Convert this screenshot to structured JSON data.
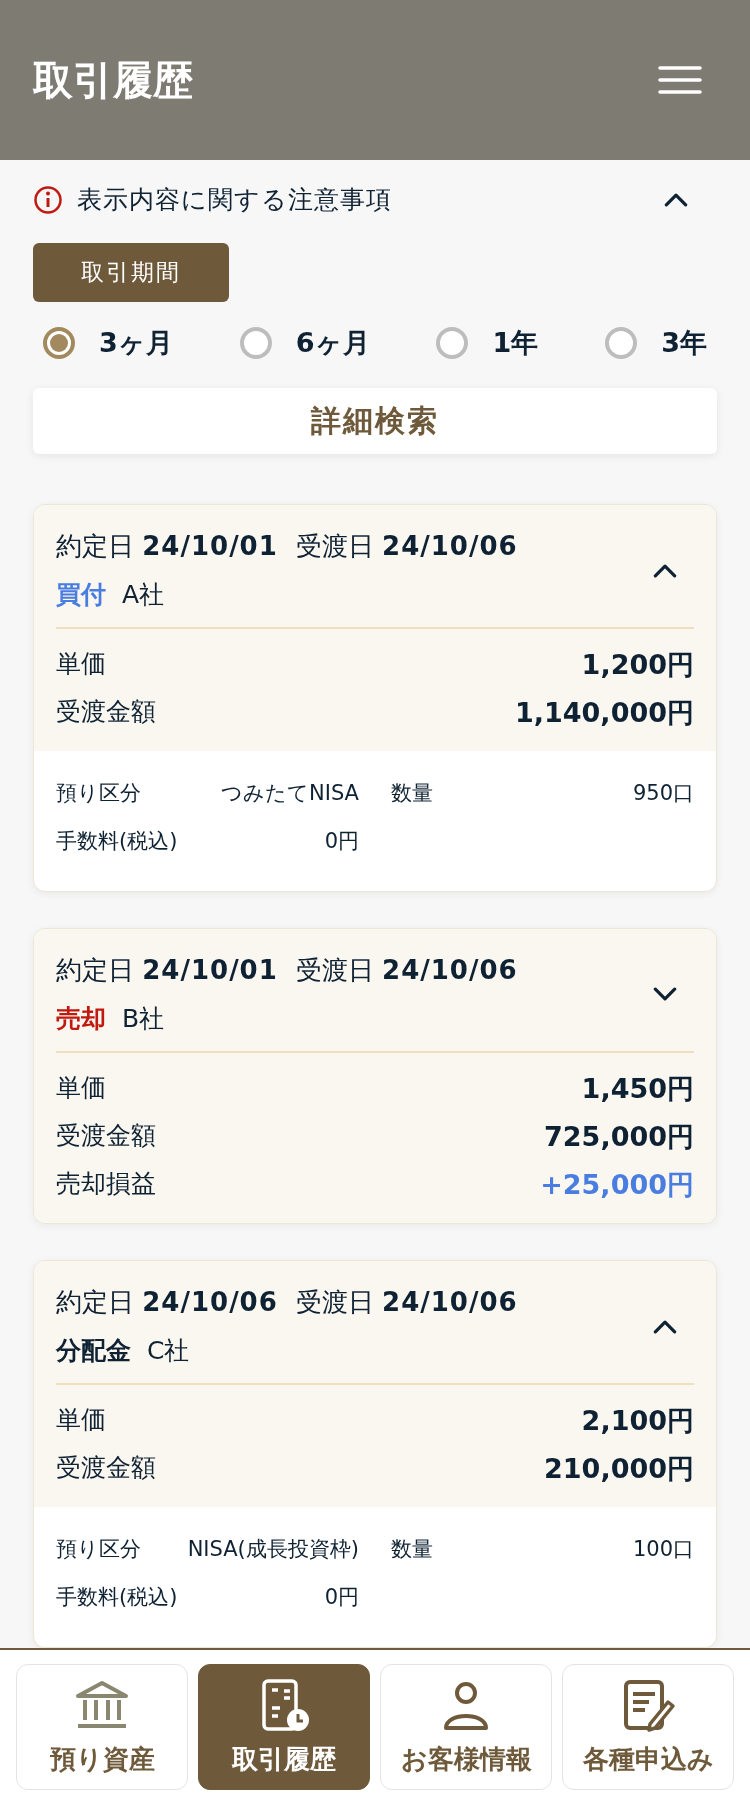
{
  "header": {
    "title": "取引履歴"
  },
  "notice": {
    "label": "表示内容に関する注意事項",
    "expanded": true
  },
  "period": {
    "label": "取引期間",
    "options": [
      {
        "label": "3ヶ月",
        "selected": true
      },
      {
        "label": "6ヶ月",
        "selected": false
      },
      {
        "label": "1年",
        "selected": false
      },
      {
        "label": "3年",
        "selected": false
      }
    ]
  },
  "search_button": "詳細検索",
  "trades": [
    {
      "trade_date_label": "約定日",
      "trade_date": "24/10/01",
      "settle_date_label": "受渡日",
      "settle_date": "24/10/06",
      "type": "買付",
      "kind": "buy",
      "company": "A社",
      "expanded": true,
      "rows": [
        {
          "label": "単価",
          "value": "1,200円",
          "kind": "plain"
        },
        {
          "label": "受渡金額",
          "value": "1,140,000円",
          "kind": "plain"
        }
      ],
      "details": [
        {
          "label": "預り区分",
          "value": "つみたてNISA"
        },
        {
          "label": "数量",
          "value": "950口"
        },
        {
          "label": "手数料(税込)",
          "value": "0円"
        }
      ]
    },
    {
      "trade_date_label": "約定日",
      "trade_date": "24/10/01",
      "settle_date_label": "受渡日",
      "settle_date": "24/10/06",
      "type": "売却",
      "kind": "sell",
      "company": "B社",
      "expanded": false,
      "rows": [
        {
          "label": "単価",
          "value": "1,450円",
          "kind": "plain"
        },
        {
          "label": "受渡金額",
          "value": "725,000円",
          "kind": "plain"
        },
        {
          "label": "売却損益",
          "value": "+25,000円",
          "kind": "gain"
        }
      ]
    },
    {
      "trade_date_label": "約定日",
      "trade_date": "24/10/06",
      "settle_date_label": "受渡日",
      "settle_date": "24/10/06",
      "type": "分配金",
      "kind": "dividend",
      "company": "C社",
      "expanded": true,
      "rows": [
        {
          "label": "単価",
          "value": "2,100円",
          "kind": "plain"
        },
        {
          "label": "受渡金額",
          "value": "210,000円",
          "kind": "plain"
        }
      ],
      "details": [
        {
          "label": "預り区分",
          "value": "NISA(成長投資枠)"
        },
        {
          "label": "数量",
          "value": "100口"
        },
        {
          "label": "手数料(税込)",
          "value": "0円"
        }
      ]
    }
  ],
  "nav": [
    {
      "label": "預り資産",
      "kind": "bank",
      "selected": false
    },
    {
      "label": "取引履歴",
      "kind": "history",
      "selected": true
    },
    {
      "label": "お客様情報",
      "kind": "person",
      "selected": false
    },
    {
      "label": "各種申込み",
      "kind": "form",
      "selected": false
    }
  ]
}
